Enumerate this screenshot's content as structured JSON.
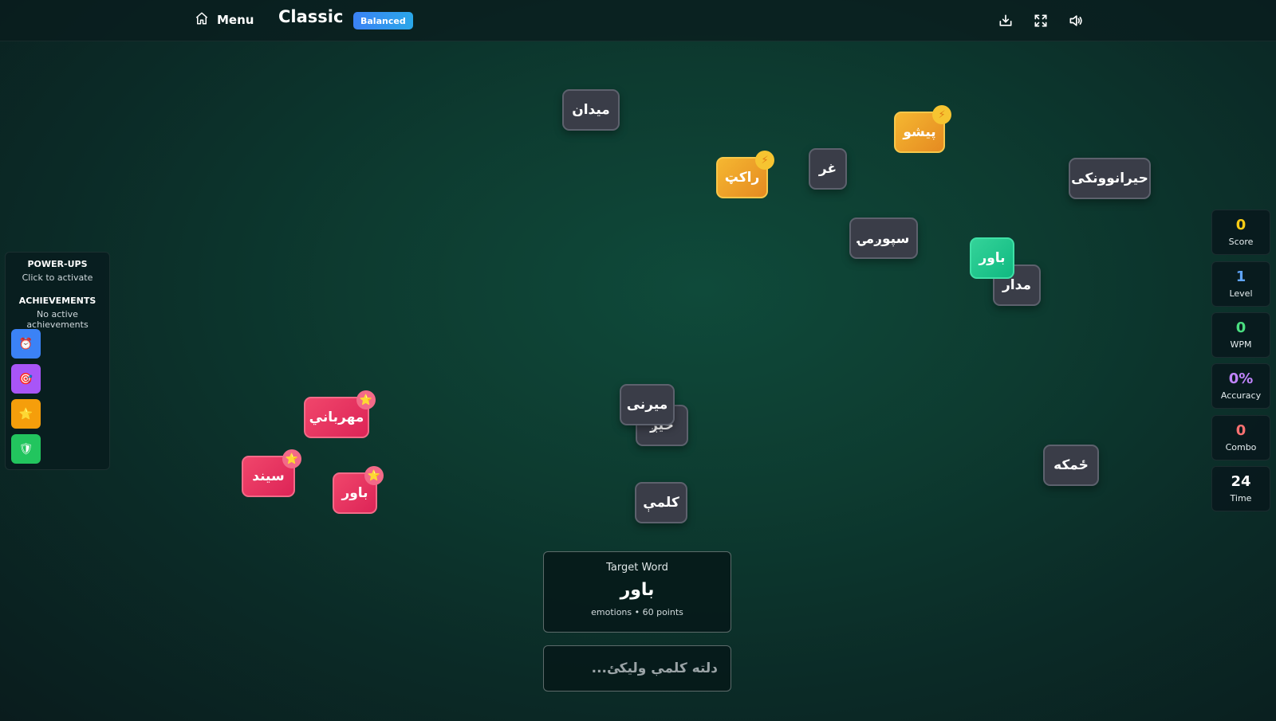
{
  "header": {
    "menu_label": "Menu",
    "mode_title": "Classic",
    "difficulty_badge": "Balanced",
    "icons": [
      "home-icon",
      "download-icon",
      "fullscreen-icon",
      "volume-icon"
    ]
  },
  "left_panel": {
    "powerups_heading": "POWER-UPS",
    "powerups_sub": "Click to activate",
    "achievements_heading": "ACHIEVEMENTS",
    "achievements_sub": "No active achievements",
    "powerups": [
      {
        "icon": "alarm-clock-icon",
        "glyph": "⏰",
        "color": "#3b82f6"
      },
      {
        "icon": "target-icon",
        "glyph": "🎯",
        "color": "#a855f7"
      },
      {
        "icon": "star-icon",
        "glyph": "⭐",
        "color": "#f59e0b"
      },
      {
        "icon": "shield-icon",
        "glyph": "🛡",
        "color": "#22c55e"
      }
    ]
  },
  "stats": [
    {
      "value": "0",
      "label": "Score",
      "color": "#facc15"
    },
    {
      "value": "1",
      "label": "Level",
      "color": "#60a5fa"
    },
    {
      "value": "0",
      "label": "WPM",
      "color": "#4ade80"
    },
    {
      "value": "0%",
      "label": "Accuracy",
      "color": "#c084fc"
    },
    {
      "value": "0",
      "label": "Combo",
      "color": "#f87171"
    },
    {
      "value": "24",
      "label": "Time",
      "color": "#ffffff"
    }
  ],
  "words": [
    {
      "text": "میدان",
      "style": "gray"
    },
    {
      "text": "پیشو",
      "style": "orange",
      "badge": "⚡"
    },
    {
      "text": "راکټ",
      "style": "orange",
      "badge": "⚡"
    },
    {
      "text": "غر",
      "style": "gray"
    },
    {
      "text": "حیرانوونکی",
      "style": "gray"
    },
    {
      "text": "سپوږمۍ",
      "style": "gray"
    },
    {
      "text": "مدار",
      "style": "gray"
    },
    {
      "text": "باور",
      "style": "green"
    },
    {
      "text": "ځیږ",
      "style": "gray"
    },
    {
      "text": "میرنی",
      "style": "gray"
    },
    {
      "text": "مهرباني",
      "style": "pink",
      "badge": "⭐"
    },
    {
      "text": "سیند",
      "style": "pink",
      "badge": "⭐"
    },
    {
      "text": "باور",
      "style": "pink",
      "badge": "⭐"
    },
    {
      "text": "کلمې",
      "style": "gray"
    },
    {
      "text": "ځمکه",
      "style": "gray"
    }
  ],
  "target": {
    "label": "Target Word",
    "word": "باور",
    "info": "emotions • 60 points"
  },
  "input": {
    "placeholder": "دلته کلمې ولیکئ...",
    "value": ""
  }
}
